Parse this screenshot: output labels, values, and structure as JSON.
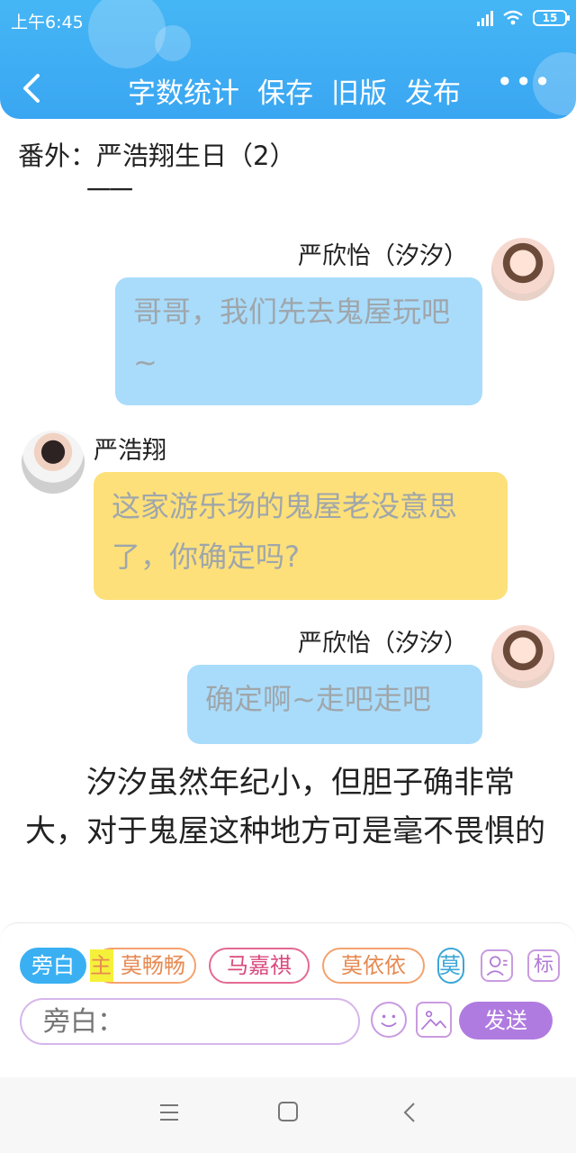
{
  "status_bar": {
    "time": "上午6:45",
    "battery": "15"
  },
  "header": {
    "back_icon": "chevron-left-icon",
    "actions": [
      "字数统计",
      "保存",
      "旧版",
      "发布"
    ],
    "more_label": "•••"
  },
  "document": {
    "title": "番外：严浩翔生日（2）",
    "dash": "一一"
  },
  "messages": [
    {
      "speaker": "严欣怡（汐汐）",
      "text": "哥哥，我们先去鬼屋玩吧~",
      "side": "right",
      "color": "#a9dcfb"
    },
    {
      "speaker": "严浩翔",
      "text": "这家游乐场的鬼屋老没意思了，你确定吗?",
      "side": "left",
      "color": "#fde07a"
    },
    {
      "speaker": "严欣怡（汐汐）",
      "text": "确定啊~走吧走吧",
      "side": "right",
      "color": "#a9dcfb"
    }
  ],
  "narration": "汐汐虽然年纪小，但胆子确非常大，对于鬼屋这种地方可是毫不畏惧的",
  "input_panel": {
    "chips": [
      "旁白",
      "莫畅畅",
      "马嘉祺",
      "莫依依",
      "莫"
    ],
    "highlight_char": "主",
    "tag_label": "标",
    "placeholder": "旁白：",
    "send_label": "发送"
  }
}
